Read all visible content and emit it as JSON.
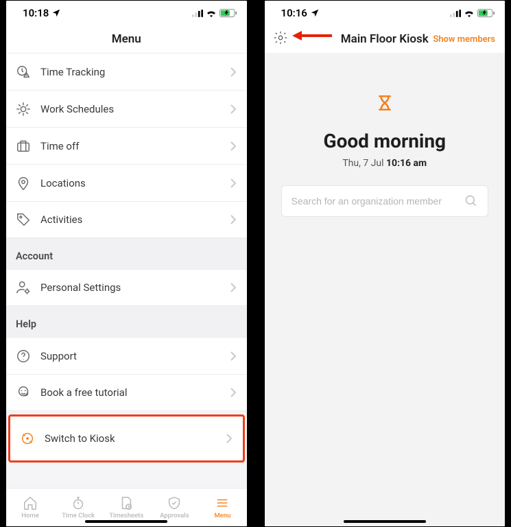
{
  "left": {
    "status": {
      "time": "10:18"
    },
    "title": "Menu",
    "menu": {
      "time_tracking": "Time Tracking",
      "work_schedules": "Work Schedules",
      "time_off": "Time off",
      "locations": "Locations",
      "activities": "Activities"
    },
    "account": {
      "header": "Account",
      "personal_settings": "Personal Settings"
    },
    "help": {
      "header": "Help",
      "support": "Support",
      "book_tutorial": "Book a free tutorial",
      "switch_to_kiosk": "Switch to Kiosk"
    },
    "tabs": {
      "home": "Home",
      "time_clock": "Time Clock",
      "timesheets": "Timesheets",
      "approvals": "Approvals",
      "menu": "Menu"
    }
  },
  "right": {
    "status": {
      "time": "10:16"
    },
    "title": "Main Floor Kiosk",
    "show_members": "Show members",
    "greeting": "Good morning",
    "date_prefix": "Thu, 7 Jul ",
    "time": "10:16 am",
    "search_placeholder": "Search for an organization member"
  }
}
